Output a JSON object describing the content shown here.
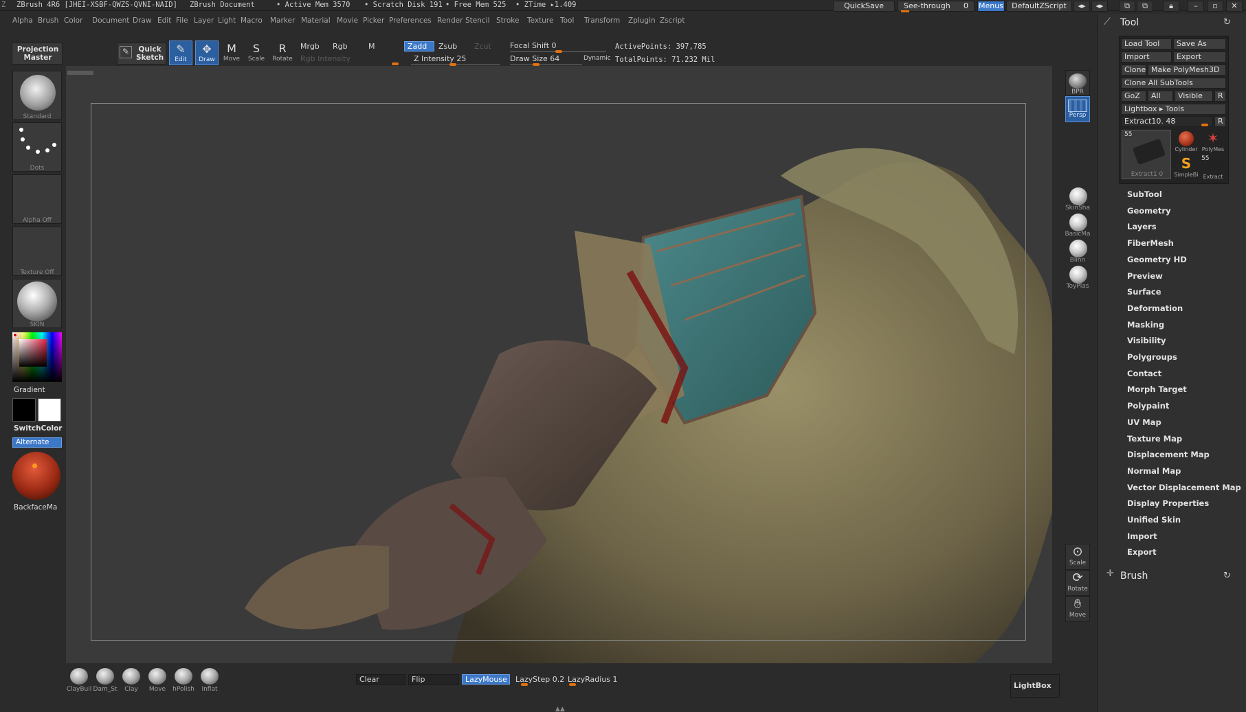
{
  "titlebar": {
    "app": "ZBrush 4R6 [JHEI-XSBF-QWZS-QVNI-NAID]",
    "document": "ZBrush Document",
    "active_mem": "• Active Mem 3570",
    "scratch_disk": "• Scratch Disk 191",
    "free_mem": "• Free Mem 525",
    "ztime": "• ZTime ▸1.409",
    "quicksave": "QuickSave",
    "see_through": "See-through",
    "see_through_value": "0",
    "menus": "Menus",
    "default_script": "DefaultZScript"
  },
  "menubar": [
    "Alpha",
    "Brush",
    "Color",
    "Document",
    "Draw",
    "Edit",
    "File",
    "Layer",
    "Light",
    "Macro",
    "Marker",
    "Material",
    "Movie",
    "Picker",
    "Preferences",
    "Render",
    "Stencil",
    "Stroke",
    "Texture",
    "Tool",
    "Transform",
    "Zplugin",
    "Zscript"
  ],
  "shelf": {
    "projection_master": "Projection Master",
    "quick_sketch": "Quick Sketch",
    "tools": [
      {
        "label": "Edit",
        "icon": "edit-icon",
        "glyph": "✎",
        "active": true
      },
      {
        "label": "Draw",
        "icon": "draw-icon",
        "glyph": "✥",
        "active": true
      },
      {
        "label": "Move",
        "icon": "move-icon",
        "glyph": "M",
        "active": false
      },
      {
        "label": "Scale",
        "icon": "scale-icon",
        "glyph": "S",
        "active": false
      },
      {
        "label": "Rotate",
        "icon": "rotate-icon",
        "glyph": "R",
        "active": false
      }
    ],
    "mrgb": "Mrgb",
    "rgb": "Rgb",
    "m": "M",
    "rgb_intensity": "Rgb Intensity",
    "zadd": "Zadd",
    "zsub": "Zsub",
    "zcut": "Zcut",
    "z_intensity": "Z Intensity 25",
    "focal_shift": "Focal Shift 0",
    "draw_size": "Draw Size 64",
    "dynamic": "Dynamic",
    "active_points": "ActivePoints: 397,785",
    "total_points": "TotalPoints: 71.232 Mil"
  },
  "left": {
    "brush": "Standard",
    "stroke": "Dots",
    "alpha": "Alpha Off",
    "texture": "Texture Off",
    "material": "SKIN",
    "gradient": "Gradient",
    "switch_color": "SwitchColor",
    "alternate": "Alternate",
    "backface": "BackfaceMa"
  },
  "right_shelf": {
    "bpr": "BPR",
    "persp": "Persp",
    "materials": [
      "SkinSha",
      "BasicMa",
      "Blinn",
      "ToyPlas"
    ],
    "scale": "Scale",
    "rotate": "Rotate",
    "move": "Move"
  },
  "tool_panel": {
    "title": "Tool",
    "load_tool": "Load Tool",
    "save_as": "Save As",
    "import": "Import",
    "export": "Export",
    "clone": "Clone",
    "make_polymesh": "Make PolyMesh3D",
    "clone_all": "Clone All SubTools",
    "goz": "GoZ",
    "all": "All",
    "visible": "Visible",
    "r": "R",
    "lightbox_tools": "Lightbox ▸ Tools",
    "extract_slider": "Extract10. 48",
    "thumb_count": "55",
    "thumb_main": "Extract1 0",
    "thumbs": [
      "Cylinder",
      "PolyMes",
      "SimpleBi",
      "Extract"
    ],
    "thumb_count2": "55",
    "items": [
      "SubTool",
      "Geometry",
      "Layers",
      "FiberMesh",
      "Geometry HD",
      "Preview",
      "Surface",
      "Deformation",
      "Masking",
      "Visibility",
      "Polygroups",
      "Contact",
      "Morph Target",
      "Polypaint",
      "UV Map",
      "Texture Map",
      "Displacement Map",
      "Normal Map",
      "Vector Displacement Map",
      "Display Properties",
      "Unified Skin",
      "Import",
      "Export"
    ],
    "brush_title": "Brush"
  },
  "bottom": {
    "brushes": [
      "ClayBuil",
      "Dam_St",
      "Clay",
      "Move",
      "hPolish",
      "Inflat"
    ],
    "clear": "Clear",
    "flip": "Flip",
    "lazymouse": "LazyMouse",
    "lazystep": "LazyStep 0.2",
    "lazyradius": "LazyRadius 1",
    "lightbox": "LightBox"
  },
  "colors": {
    "accent": "#3c78c8",
    "orange": "#e07010",
    "panel": "#303030"
  }
}
